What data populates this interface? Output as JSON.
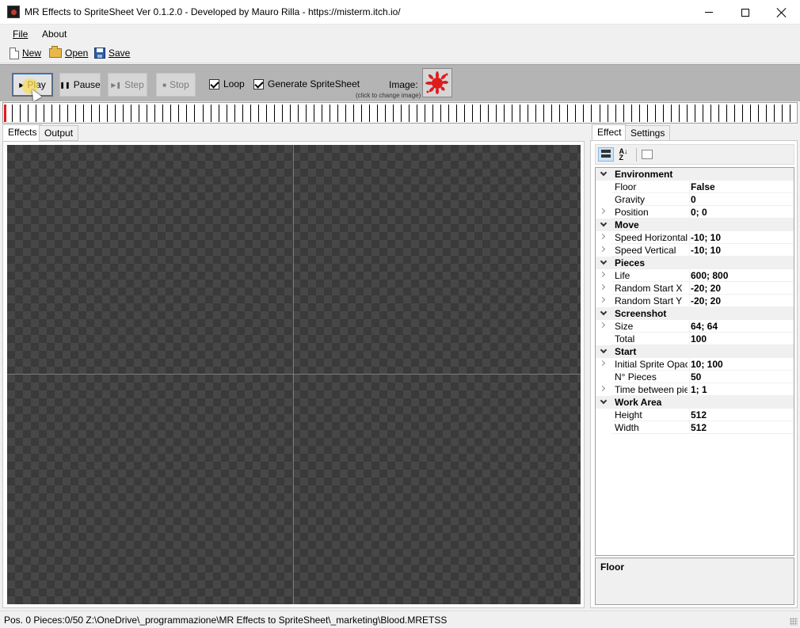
{
  "window": {
    "title": "MR Effects to SpriteSheet Ver 0.1.2.0 -  Developed by Mauro Rilla  - https://misterm.itch.io/"
  },
  "menu": {
    "file": "File",
    "about": "About"
  },
  "toolbar": {
    "new_label": "New",
    "open_label": "Open",
    "save_label": "Save"
  },
  "player": {
    "play_label": "Play",
    "pause_label": "Pause",
    "step_label": "Step",
    "stop_label": "Stop",
    "play_glyph": "▶",
    "pause_glyph": "❚❚",
    "step_glyph": "▶❚",
    "stop_glyph": "■",
    "loop_label": "Loop",
    "loop_checked": true,
    "generate_label": "Generate SpriteSheet",
    "generate_checked": true,
    "image_label": "Image:",
    "image_hint": "(click to change image)",
    "image_color": "#e01b1b"
  },
  "timeline": {
    "tick_count": 100,
    "position": 0,
    "marker_color": "#e11b1b"
  },
  "left_tabs": [
    "Effects",
    "Output"
  ],
  "right_tabs": [
    "Effect",
    "Settings"
  ],
  "property_grid": {
    "toolbar_icons": [
      "categorized-icon",
      "alphabetical-icon",
      "property-pages-icon"
    ],
    "rows": [
      {
        "type": "category",
        "name": "Environment"
      },
      {
        "type": "property",
        "name": "Floor",
        "value": "False",
        "expandable": false
      },
      {
        "type": "property",
        "name": "Gravity",
        "value": "0",
        "expandable": false
      },
      {
        "type": "property",
        "name": "Position",
        "value": "0; 0",
        "expandable": true
      },
      {
        "type": "category",
        "name": "Move"
      },
      {
        "type": "property",
        "name": "Speed Horizontal",
        "value": "-10; 10",
        "expandable": true
      },
      {
        "type": "property",
        "name": "Speed Vertical",
        "value": "-10; 10",
        "expandable": true
      },
      {
        "type": "category",
        "name": "Pieces"
      },
      {
        "type": "property",
        "name": "Life",
        "value": "600; 800",
        "expandable": true
      },
      {
        "type": "property",
        "name": "Random Start X",
        "value": "-20; 20",
        "expandable": true
      },
      {
        "type": "property",
        "name": "Random Start Y",
        "value": "-20; 20",
        "expandable": true
      },
      {
        "type": "category",
        "name": "Screenshot"
      },
      {
        "type": "property",
        "name": "Size",
        "value": "64; 64",
        "expandable": true
      },
      {
        "type": "property",
        "name": "Total",
        "value": "100",
        "expandable": false
      },
      {
        "type": "category",
        "name": "Start"
      },
      {
        "type": "property",
        "name": "Initial Sprite Opacity",
        "value": "10; 100",
        "expandable": true
      },
      {
        "type": "property",
        "name": "N° Pieces",
        "value": "50",
        "expandable": false
      },
      {
        "type": "property",
        "name": "Time between piec",
        "value": "1; 1",
        "expandable": true
      },
      {
        "type": "category",
        "name": "Work Area"
      },
      {
        "type": "property",
        "name": "Height",
        "value": "512",
        "expandable": false
      },
      {
        "type": "property",
        "name": "Width",
        "value": "512",
        "expandable": false
      }
    ],
    "help_title": "Floor"
  },
  "status": {
    "text": "Pos. 0 Pieces:0/50  Z:\\OneDrive\\_programmazione\\MR Effects to SpriteSheet\\_marketing\\Blood.MRETSS"
  }
}
